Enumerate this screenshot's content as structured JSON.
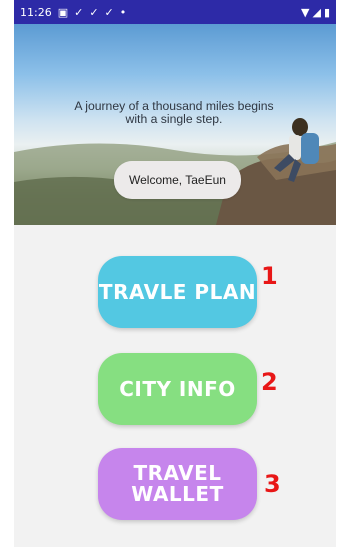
{
  "status": {
    "time": "11:26",
    "icons": [
      "notification-icon",
      "check-icon",
      "check-icon",
      "check-icon",
      "dot-icon"
    ],
    "right_icons": [
      "wifi-icon",
      "signal-icon",
      "battery-icon"
    ]
  },
  "hero": {
    "quote": "A journey of a thousand miles begins with a single step.",
    "welcome": "Welcome, TaeEun"
  },
  "menu": {
    "items": [
      {
        "label": "TRAVLE PLAN",
        "color": "#53c8e2"
      },
      {
        "label": "CITY INFO",
        "color": "#86df81"
      },
      {
        "label": "TRAVEL WALLET",
        "color": "#c685ec"
      }
    ]
  },
  "annotations": [
    "1",
    "2",
    "3"
  ]
}
